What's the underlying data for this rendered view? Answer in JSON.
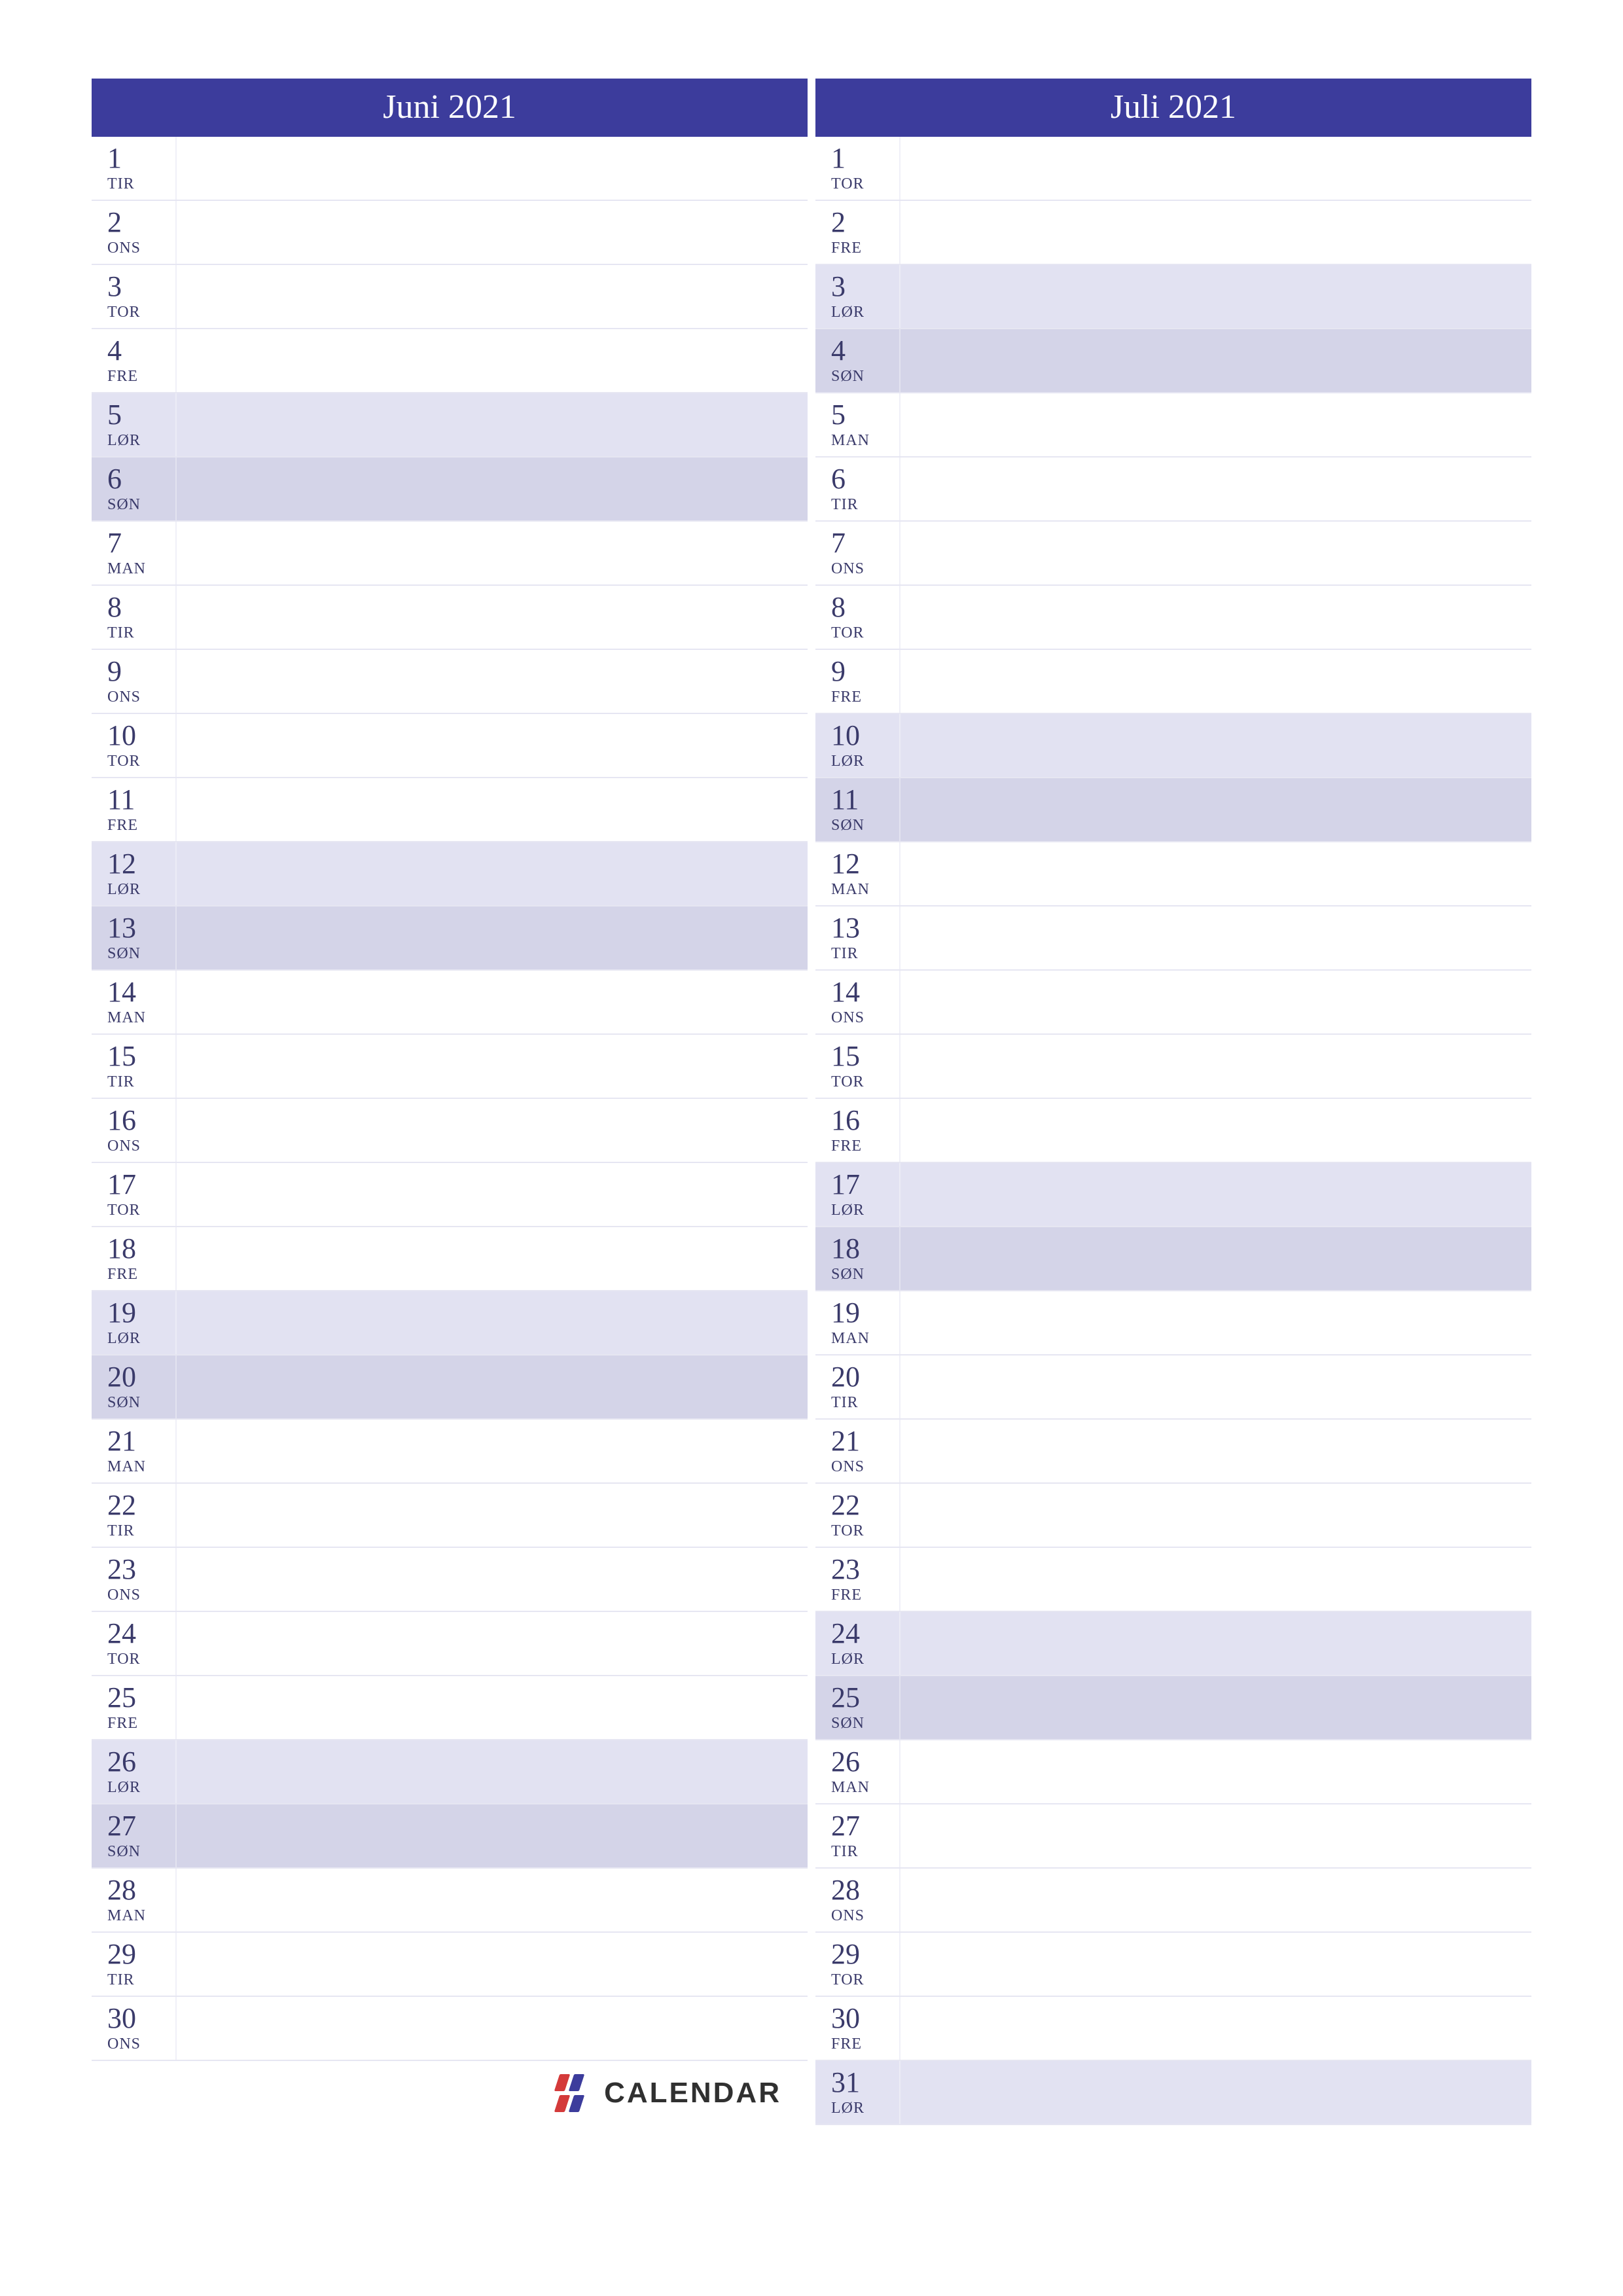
{
  "brand": "CALENDAR",
  "months": [
    {
      "title": "Juni 2021",
      "days": [
        {
          "n": "1",
          "dow": "TIR",
          "t": "wd"
        },
        {
          "n": "2",
          "dow": "ONS",
          "t": "wd"
        },
        {
          "n": "3",
          "dow": "TOR",
          "t": "wd"
        },
        {
          "n": "4",
          "dow": "FRE",
          "t": "wd"
        },
        {
          "n": "5",
          "dow": "LØR",
          "t": "sat"
        },
        {
          "n": "6",
          "dow": "SØN",
          "t": "sun"
        },
        {
          "n": "7",
          "dow": "MAN",
          "t": "wd"
        },
        {
          "n": "8",
          "dow": "TIR",
          "t": "wd"
        },
        {
          "n": "9",
          "dow": "ONS",
          "t": "wd"
        },
        {
          "n": "10",
          "dow": "TOR",
          "t": "wd"
        },
        {
          "n": "11",
          "dow": "FRE",
          "t": "wd"
        },
        {
          "n": "12",
          "dow": "LØR",
          "t": "sat"
        },
        {
          "n": "13",
          "dow": "SØN",
          "t": "sun"
        },
        {
          "n": "14",
          "dow": "MAN",
          "t": "wd"
        },
        {
          "n": "15",
          "dow": "TIR",
          "t": "wd"
        },
        {
          "n": "16",
          "dow": "ONS",
          "t": "wd"
        },
        {
          "n": "17",
          "dow": "TOR",
          "t": "wd"
        },
        {
          "n": "18",
          "dow": "FRE",
          "t": "wd"
        },
        {
          "n": "19",
          "dow": "LØR",
          "t": "sat"
        },
        {
          "n": "20",
          "dow": "SØN",
          "t": "sun"
        },
        {
          "n": "21",
          "dow": "MAN",
          "t": "wd"
        },
        {
          "n": "22",
          "dow": "TIR",
          "t": "wd"
        },
        {
          "n": "23",
          "dow": "ONS",
          "t": "wd"
        },
        {
          "n": "24",
          "dow": "TOR",
          "t": "wd"
        },
        {
          "n": "25",
          "dow": "FRE",
          "t": "wd"
        },
        {
          "n": "26",
          "dow": "LØR",
          "t": "sat"
        },
        {
          "n": "27",
          "dow": "SØN",
          "t": "sun"
        },
        {
          "n": "28",
          "dow": "MAN",
          "t": "wd"
        },
        {
          "n": "29",
          "dow": "TIR",
          "t": "wd"
        },
        {
          "n": "30",
          "dow": "ONS",
          "t": "wd"
        }
      ]
    },
    {
      "title": "Juli 2021",
      "days": [
        {
          "n": "1",
          "dow": "TOR",
          "t": "wd"
        },
        {
          "n": "2",
          "dow": "FRE",
          "t": "wd"
        },
        {
          "n": "3",
          "dow": "LØR",
          "t": "sat"
        },
        {
          "n": "4",
          "dow": "SØN",
          "t": "sun"
        },
        {
          "n": "5",
          "dow": "MAN",
          "t": "wd"
        },
        {
          "n": "6",
          "dow": "TIR",
          "t": "wd"
        },
        {
          "n": "7",
          "dow": "ONS",
          "t": "wd"
        },
        {
          "n": "8",
          "dow": "TOR",
          "t": "wd"
        },
        {
          "n": "9",
          "dow": "FRE",
          "t": "wd"
        },
        {
          "n": "10",
          "dow": "LØR",
          "t": "sat"
        },
        {
          "n": "11",
          "dow": "SØN",
          "t": "sun"
        },
        {
          "n": "12",
          "dow": "MAN",
          "t": "wd"
        },
        {
          "n": "13",
          "dow": "TIR",
          "t": "wd"
        },
        {
          "n": "14",
          "dow": "ONS",
          "t": "wd"
        },
        {
          "n": "15",
          "dow": "TOR",
          "t": "wd"
        },
        {
          "n": "16",
          "dow": "FRE",
          "t": "wd"
        },
        {
          "n": "17",
          "dow": "LØR",
          "t": "sat"
        },
        {
          "n": "18",
          "dow": "SØN",
          "t": "sun"
        },
        {
          "n": "19",
          "dow": "MAN",
          "t": "wd"
        },
        {
          "n": "20",
          "dow": "TIR",
          "t": "wd"
        },
        {
          "n": "21",
          "dow": "ONS",
          "t": "wd"
        },
        {
          "n": "22",
          "dow": "TOR",
          "t": "wd"
        },
        {
          "n": "23",
          "dow": "FRE",
          "t": "wd"
        },
        {
          "n": "24",
          "dow": "LØR",
          "t": "sat"
        },
        {
          "n": "25",
          "dow": "SØN",
          "t": "sun"
        },
        {
          "n": "26",
          "dow": "MAN",
          "t": "wd"
        },
        {
          "n": "27",
          "dow": "TIR",
          "t": "wd"
        },
        {
          "n": "28",
          "dow": "ONS",
          "t": "wd"
        },
        {
          "n": "29",
          "dow": "TOR",
          "t": "wd"
        },
        {
          "n": "30",
          "dow": "FRE",
          "t": "wd"
        },
        {
          "n": "31",
          "dow": "LØR",
          "t": "sat"
        }
      ]
    }
  ]
}
